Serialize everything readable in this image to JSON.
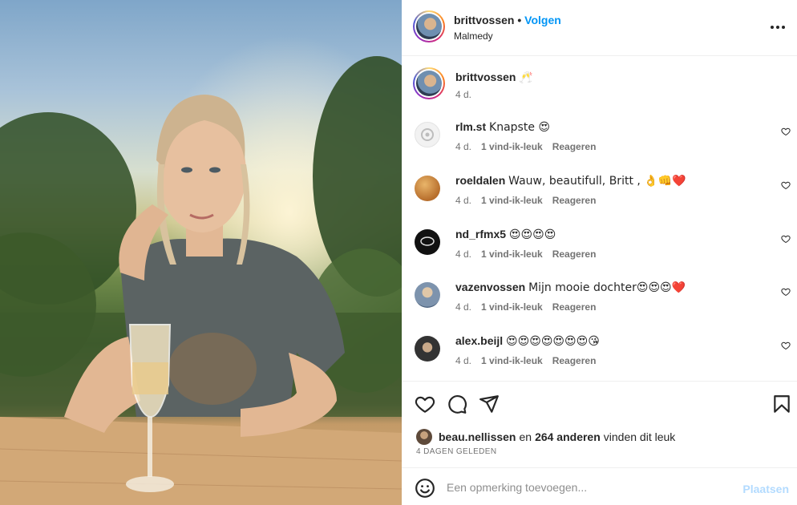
{
  "post": {
    "username": "brittvossen",
    "follow_label": "Volgen",
    "location": "Malmedy",
    "caption_emoji": "🥂",
    "caption_age": "4 d.",
    "photo_alt": "Woman sitting at a wooden table with a glass of champagne at sunset"
  },
  "comments": [
    {
      "user": "rlm.st",
      "text": "Knapste 😍",
      "age": "4 d.",
      "likes": "1 vind-ik-leuk",
      "reply": "Reageren",
      "avatar_color": "#f2f2f2"
    },
    {
      "user": "roeldalen",
      "text": "Wauw, beautifull, Britt , 👌👊❤️",
      "age": "4 d.",
      "likes": "1 vind-ik-leuk",
      "reply": "Reageren",
      "avatar_color": "#c98a3c"
    },
    {
      "user": "nd_rfmx5",
      "text": "😍😍😍😍",
      "age": "4 d.",
      "likes": "1 vind-ik-leuk",
      "reply": "Reageren",
      "avatar_color": "#111111"
    },
    {
      "user": "vazenvossen",
      "text": "Mijn mooie dochter😍😍😍❤️",
      "age": "4 d.",
      "likes": "1 vind-ik-leuk",
      "reply": "Reageren",
      "avatar_color": "#8aa0b8"
    },
    {
      "user": "alex.beijl",
      "text": "😍😍😍😍😍😍😍😘",
      "age": "4 d.",
      "likes": "1 vind-ik-leuk",
      "reply": "Reageren",
      "avatar_color": "#3a3a3a"
    }
  ],
  "likes_line": {
    "user": "beau.nellissen",
    "connector": "en",
    "others": "264 anderen",
    "suffix": "vinden dit leuk"
  },
  "date_label": "4 DAGEN GELEDEN",
  "comment_box": {
    "placeholder": "Een opmerking toevoegen...",
    "post_label": "Plaatsen"
  },
  "colors": {
    "accent": "#0095f6",
    "muted": "#737373",
    "post_disabled": "#b3dbff"
  }
}
